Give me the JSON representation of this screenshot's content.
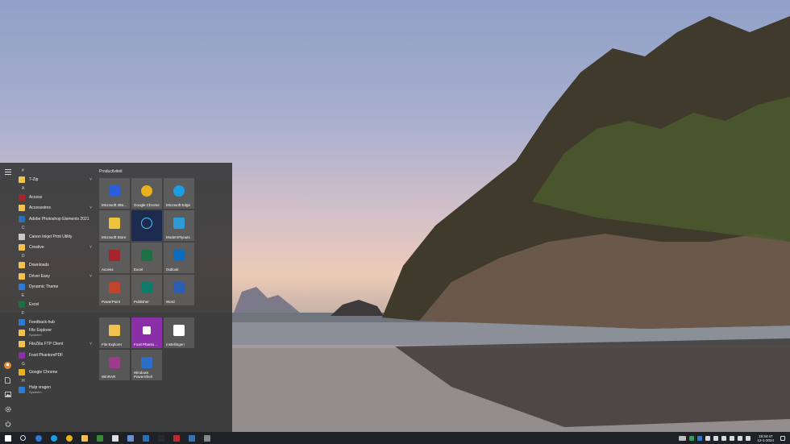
{
  "start_menu": {
    "apps": [
      {
        "type": "letter",
        "text": "#"
      },
      {
        "type": "app",
        "label": "7-Zip",
        "icon": "folder-icon",
        "color": "#f2c14e",
        "chevron": true
      },
      {
        "type": "letter",
        "text": "A"
      },
      {
        "type": "app",
        "label": "Access",
        "icon": "access-icon",
        "color": "#a4262c"
      },
      {
        "type": "app",
        "label": "Accessoires",
        "icon": "folder-icon",
        "color": "#f2c14e",
        "chevron": true
      },
      {
        "type": "app",
        "label": "Adobe Photoshop Elements 2021",
        "icon": "photoshop-icon",
        "color": "#2d6fb5"
      },
      {
        "type": "letter",
        "text": "C"
      },
      {
        "type": "app",
        "label": "Canon Inkjet Print Utility",
        "icon": "canon-icon",
        "color": "#c8c8c8"
      },
      {
        "type": "app",
        "label": "Creative",
        "icon": "folder-icon",
        "color": "#f2c14e",
        "chevron": true
      },
      {
        "type": "letter",
        "text": "D"
      },
      {
        "type": "app",
        "label": "Downloads",
        "icon": "folder-icon",
        "color": "#f2c14e"
      },
      {
        "type": "app",
        "label": "Driver Easy",
        "icon": "folder-icon",
        "color": "#f2c14e",
        "chevron": true
      },
      {
        "type": "app",
        "label": "Dynamic Theme",
        "icon": "theme-icon",
        "color": "#2e7bd6"
      },
      {
        "type": "letter",
        "text": "E"
      },
      {
        "type": "app",
        "label": "Excel",
        "icon": "excel-icon",
        "color": "#1d7044"
      },
      {
        "type": "letter",
        "text": "F"
      },
      {
        "type": "app",
        "label": "Feedback-hub",
        "icon": "feedback-icon",
        "color": "#2e7bd6"
      },
      {
        "type": "app",
        "label": "File Explorer",
        "sub": "Systeem",
        "icon": "folder-icon",
        "color": "#f2c14e"
      },
      {
        "type": "app",
        "label": "FileZilla FTP Client",
        "icon": "folder-icon",
        "color": "#f2c14e",
        "chevron": true
      },
      {
        "type": "app",
        "label": "Foxit PhantomPDF",
        "icon": "foxit-icon",
        "color": "#8b2fa8"
      },
      {
        "type": "letter",
        "text": "G"
      },
      {
        "type": "app",
        "label": "Google Chrome",
        "icon": "chrome-icon",
        "color": "#e8b21f"
      },
      {
        "type": "letter",
        "text": "H"
      },
      {
        "type": "app",
        "label": "Hulp vragen",
        "sub": "Systeem",
        "icon": "help-icon",
        "color": "#2e7bd6"
      }
    ],
    "group_title": "Productiviteit",
    "tiles": [
      {
        "label": "Microsoft 365...",
        "icon": "office-icon",
        "color": "#2b5fd9"
      },
      {
        "label": "Google Chrome",
        "icon": "chrome-icon",
        "color": "#e8b21f"
      },
      {
        "label": "Microsoft Edge",
        "icon": "edge-icon",
        "color": "#1b9de2"
      },
      {
        "label": "Microsoft Store",
        "icon": "store-icon",
        "color": "#f0c33c"
      },
      {
        "label": "",
        "icon": "photoshop-elements-icon",
        "color": "#1c2a4f",
        "highlight": true
      },
      {
        "label": "ModernFlyouts",
        "icon": "flyouts-icon",
        "color": "#2c9ad6"
      },
      {
        "label": "Access",
        "icon": "access-icon",
        "color": "#a4262c"
      },
      {
        "label": "Excel",
        "icon": "excel-icon",
        "color": "#1d7044"
      },
      {
        "label": "Outlook",
        "icon": "outlook-icon",
        "color": "#0f6cbd"
      },
      {
        "label": "PowerPoint",
        "icon": "powerpoint-icon",
        "color": "#c4432b"
      },
      {
        "label": "Publisher",
        "icon": "publisher-icon",
        "color": "#0f7b6c"
      },
      {
        "label": "Word",
        "icon": "word-icon",
        "color": "#2b5fb5"
      },
      {
        "label": "File Explorer",
        "icon": "folder-icon",
        "color": "#f2c14e"
      },
      {
        "label": "Foxit Phanto...",
        "icon": "foxit-icon",
        "color": "#ffffff",
        "highlight": true
      },
      {
        "label": "Instellingen",
        "icon": "gear-icon",
        "color": "#ffffff"
      },
      {
        "label": "WinRAR",
        "icon": "winrar-icon",
        "color": "#9b3b8a"
      },
      {
        "label": "Windows PowerShell",
        "icon": "powershell-icon",
        "color": "#2a6fc9"
      }
    ]
  },
  "taskbar": {
    "icons": [
      {
        "name": "start-icon",
        "color": "#ffffff"
      },
      {
        "name": "search-icon",
        "color": "#dddddd"
      },
      {
        "name": "cortana-icon",
        "color": "#2e7bd6"
      },
      {
        "name": "edge-icon",
        "color": "#1b9de2"
      },
      {
        "name": "chrome-icon",
        "color": "#e8b21f"
      },
      {
        "name": "file-explorer-icon",
        "color": "#f2c14e"
      },
      {
        "name": "store-icon",
        "color": "#3a8a3a"
      },
      {
        "name": "gear-icon",
        "color": "#dddddd"
      },
      {
        "name": "network-icon",
        "color": "#6b8fd6"
      },
      {
        "name": "photoshop-elements-icon",
        "color": "#2d6fb5"
      },
      {
        "name": "terminal-icon",
        "color": "#2a2a2a"
      },
      {
        "name": "filezilla-icon",
        "color": "#c0282d"
      },
      {
        "name": "app-icon",
        "color": "#3a6fb5"
      },
      {
        "name": "speedometer-icon",
        "color": "#888888"
      }
    ],
    "clock_time": "19:34:47",
    "clock_date": "12-1-2024"
  }
}
